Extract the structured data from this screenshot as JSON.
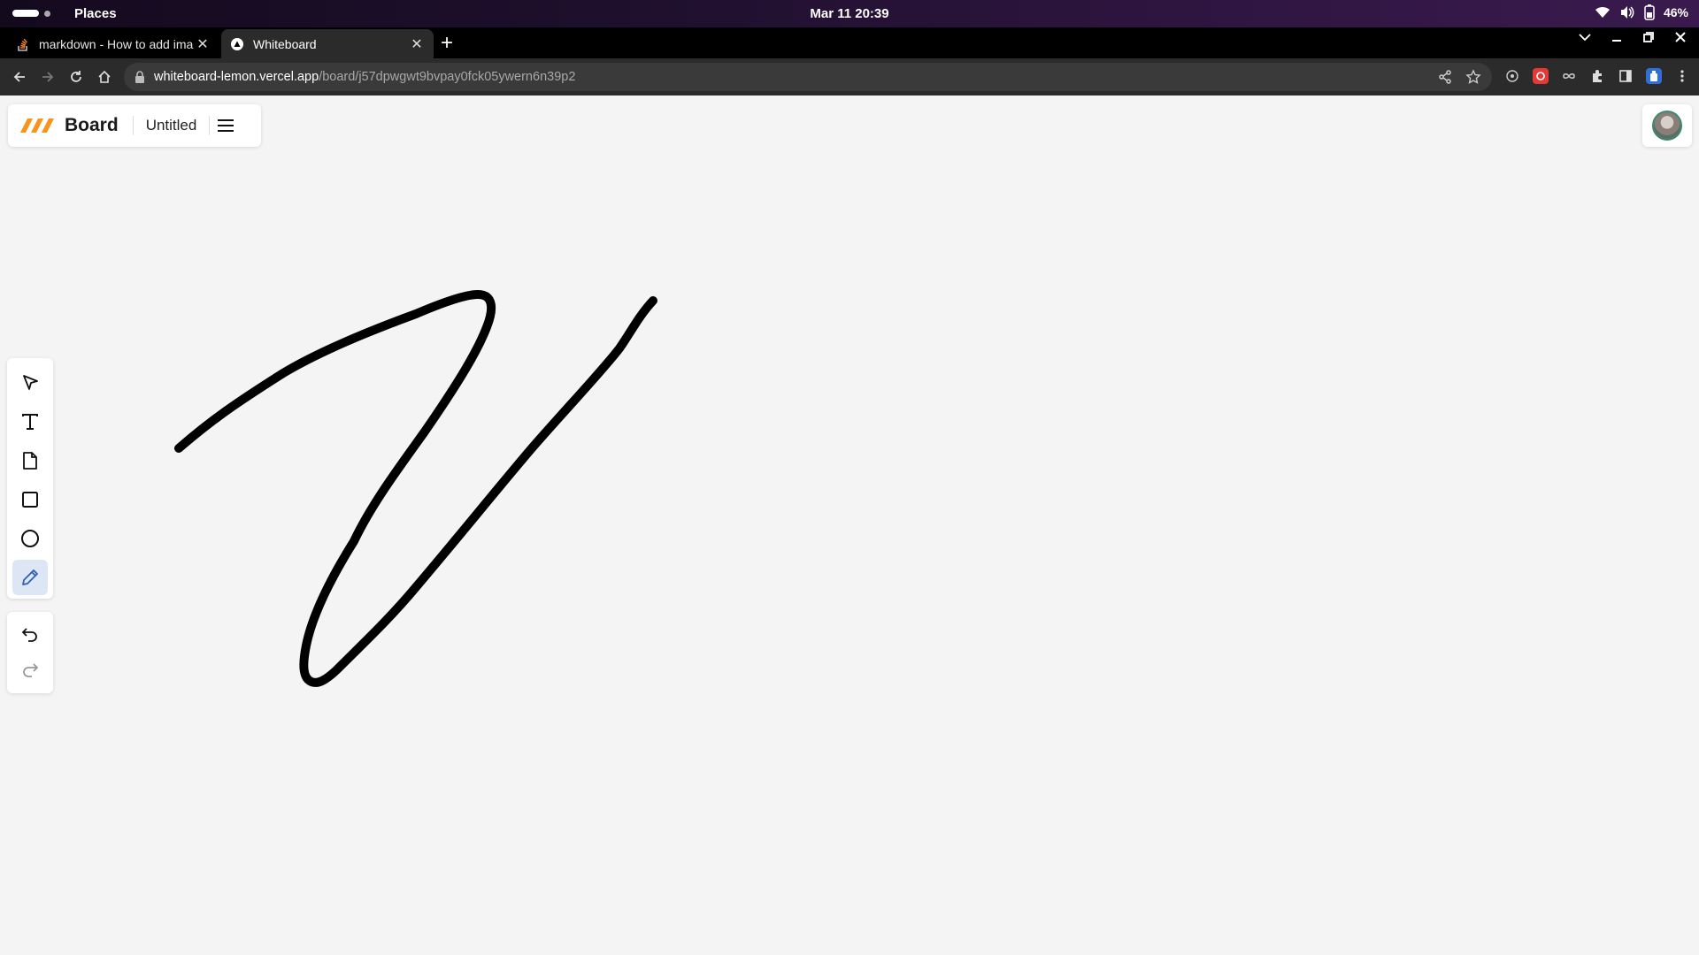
{
  "system_bar": {
    "places_label": "Places",
    "clock": "Mar 11  20:39",
    "battery": "46%"
  },
  "browser": {
    "tabs": [
      {
        "title": "markdown - How to add ima",
        "active": false,
        "favicon": "stackoverflow-icon"
      },
      {
        "title": "Whiteboard",
        "active": true,
        "favicon": "vercel-icon"
      }
    ],
    "url_host": "whiteboard-lemon.vercel.app",
    "url_path": "/board/j57dpwgwt9bvpay0fck05ywern6n39p2"
  },
  "app": {
    "brand": "Board",
    "board_title": "Untitled",
    "accent": "#f7941d",
    "tools": [
      {
        "name": "select",
        "icon": "cursor-icon"
      },
      {
        "name": "text",
        "icon": "text-icon"
      },
      {
        "name": "sticky-note",
        "icon": "note-icon"
      },
      {
        "name": "rectangle",
        "icon": "rectangle-icon"
      },
      {
        "name": "ellipse",
        "icon": "ellipse-icon"
      },
      {
        "name": "pen",
        "icon": "pencil-icon",
        "selected": true
      }
    ],
    "history": [
      {
        "name": "undo",
        "icon": "undo-icon",
        "enabled": true
      },
      {
        "name": "redo",
        "icon": "redo-icon",
        "enabled": false
      }
    ]
  }
}
